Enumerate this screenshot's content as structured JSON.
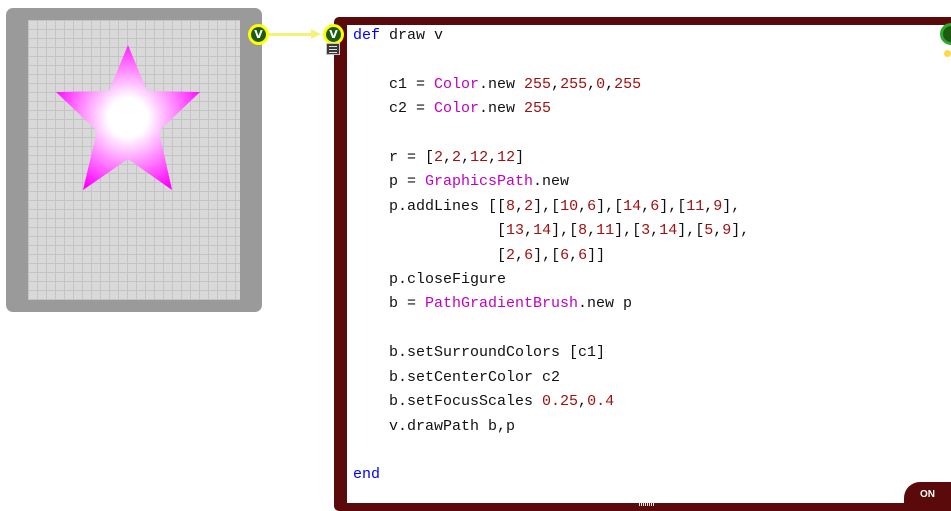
{
  "view": {
    "shape": "star",
    "surround_color": "#ff00ff",
    "center_color": "#ffffff"
  },
  "connectors": {
    "output_label": "V",
    "input_label": "V"
  },
  "code": {
    "lines": [
      [
        {
          "t": "def",
          "c": "kw"
        },
        {
          "t": " draw v",
          "c": "id"
        }
      ],
      [],
      [
        {
          "t": "    c1 = ",
          "c": "id"
        },
        {
          "t": "Color",
          "c": "cls"
        },
        {
          "t": ".new ",
          "c": "id"
        },
        {
          "t": "255",
          "c": "num"
        },
        {
          "t": ",",
          "c": "id"
        },
        {
          "t": "255",
          "c": "num"
        },
        {
          "t": ",",
          "c": "id"
        },
        {
          "t": "0",
          "c": "num"
        },
        {
          "t": ",",
          "c": "id"
        },
        {
          "t": "255",
          "c": "num"
        }
      ],
      [
        {
          "t": "    c2 = ",
          "c": "id"
        },
        {
          "t": "Color",
          "c": "cls"
        },
        {
          "t": ".new ",
          "c": "id"
        },
        {
          "t": "255",
          "c": "num"
        }
      ],
      [],
      [
        {
          "t": "    r = [",
          "c": "id"
        },
        {
          "t": "2",
          "c": "num"
        },
        {
          "t": ",",
          "c": "id"
        },
        {
          "t": "2",
          "c": "num"
        },
        {
          "t": ",",
          "c": "id"
        },
        {
          "t": "12",
          "c": "num"
        },
        {
          "t": ",",
          "c": "id"
        },
        {
          "t": "12",
          "c": "num"
        },
        {
          "t": "]",
          "c": "id"
        }
      ],
      [
        {
          "t": "    p = ",
          "c": "id"
        },
        {
          "t": "GraphicsPath",
          "c": "cls"
        },
        {
          "t": ".new",
          "c": "id"
        }
      ],
      [
        {
          "t": "    p.addLines [[",
          "c": "id"
        },
        {
          "t": "8",
          "c": "num"
        },
        {
          "t": ",",
          "c": "id"
        },
        {
          "t": "2",
          "c": "num"
        },
        {
          "t": "],[",
          "c": "id"
        },
        {
          "t": "10",
          "c": "num"
        },
        {
          "t": ",",
          "c": "id"
        },
        {
          "t": "6",
          "c": "num"
        },
        {
          "t": "],[",
          "c": "id"
        },
        {
          "t": "14",
          "c": "num"
        },
        {
          "t": ",",
          "c": "id"
        },
        {
          "t": "6",
          "c": "num"
        },
        {
          "t": "],[",
          "c": "id"
        },
        {
          "t": "11",
          "c": "num"
        },
        {
          "t": ",",
          "c": "id"
        },
        {
          "t": "9",
          "c": "num"
        },
        {
          "t": "],",
          "c": "id"
        }
      ],
      [
        {
          "t": "                [",
          "c": "id"
        },
        {
          "t": "13",
          "c": "num"
        },
        {
          "t": ",",
          "c": "id"
        },
        {
          "t": "14",
          "c": "num"
        },
        {
          "t": "],[",
          "c": "id"
        },
        {
          "t": "8",
          "c": "num"
        },
        {
          "t": ",",
          "c": "id"
        },
        {
          "t": "11",
          "c": "num"
        },
        {
          "t": "],[",
          "c": "id"
        },
        {
          "t": "3",
          "c": "num"
        },
        {
          "t": ",",
          "c": "id"
        },
        {
          "t": "14",
          "c": "num"
        },
        {
          "t": "],[",
          "c": "id"
        },
        {
          "t": "5",
          "c": "num"
        },
        {
          "t": ",",
          "c": "id"
        },
        {
          "t": "9",
          "c": "num"
        },
        {
          "t": "],",
          "c": "id"
        }
      ],
      [
        {
          "t": "                [",
          "c": "id"
        },
        {
          "t": "2",
          "c": "num"
        },
        {
          "t": ",",
          "c": "id"
        },
        {
          "t": "6",
          "c": "num"
        },
        {
          "t": "],[",
          "c": "id"
        },
        {
          "t": "6",
          "c": "num"
        },
        {
          "t": ",",
          "c": "id"
        },
        {
          "t": "6",
          "c": "num"
        },
        {
          "t": "]]",
          "c": "id"
        }
      ],
      [
        {
          "t": "    p.closeFigure",
          "c": "id"
        }
      ],
      [
        {
          "t": "    b = ",
          "c": "id"
        },
        {
          "t": "PathGradientBrush",
          "c": "cls"
        },
        {
          "t": ".new p",
          "c": "id"
        }
      ],
      [],
      [
        {
          "t": "    b.setSurroundColors [c1]",
          "c": "id"
        }
      ],
      [
        {
          "t": "    b.setCenterColor c2",
          "c": "id"
        }
      ],
      [
        {
          "t": "    b.setFocusScales ",
          "c": "id"
        },
        {
          "t": "0.25",
          "c": "num"
        },
        {
          "t": ",",
          "c": "id"
        },
        {
          "t": "0.4",
          "c": "num"
        }
      ],
      [
        {
          "t": "    v.drawPath b,p",
          "c": "id"
        }
      ],
      [],
      [
        {
          "t": "end",
          "c": "kw"
        }
      ]
    ],
    "syntax_colors": {
      "kw": "#0000ff",
      "cls": "#c000c0",
      "num": "#a01010",
      "id": "#111111"
    }
  },
  "status": {
    "badge": "ON"
  }
}
